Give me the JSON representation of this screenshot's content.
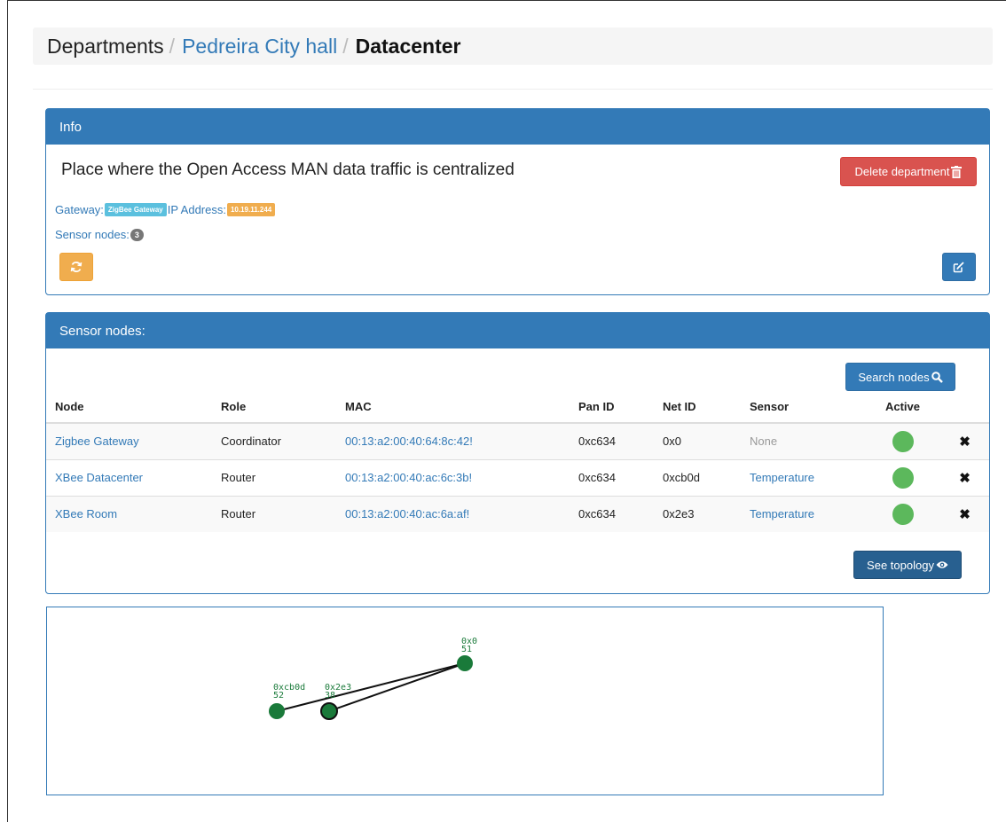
{
  "breadcrumb": {
    "root": "Departments",
    "parent": "Pedreira City hall",
    "current": "Datacenter",
    "separator": "/"
  },
  "info": {
    "heading": "Info",
    "description": "Place where the Open Access MAN data traffic is centralized",
    "delete_label": "Delete department",
    "gateway_label": "Gateway:",
    "gateway_value": "ZigBee Gateway",
    "ip_label": "IP Address:",
    "ip_value": "10.19.11.244",
    "sensor_nodes_label": "Sensor nodes:",
    "sensor_nodes_count": "3"
  },
  "sensor_panel": {
    "heading": "Sensor nodes:",
    "search_label": "Search nodes",
    "columns": [
      "Node",
      "Role",
      "MAC",
      "Pan ID",
      "Net ID",
      "Sensor",
      "Active"
    ],
    "rows": [
      {
        "node": "Zigbee Gateway",
        "role": "Coordinator",
        "mac": "00:13:a2:00:40:64:8c:42!",
        "pan_id": "0xc634",
        "net_id": "0x0",
        "sensor": "None",
        "active": true
      },
      {
        "node": "XBee Datacenter",
        "role": "Router",
        "mac": "00:13:a2:00:40:ac:6c:3b!",
        "pan_id": "0xc634",
        "net_id": "0xcb0d",
        "sensor": "Temperature",
        "active": true
      },
      {
        "node": "XBee Room",
        "role": "Router",
        "mac": "00:13:a2:00:40:ac:6a:af!",
        "pan_id": "0xc634",
        "net_id": "0x2e3",
        "sensor": "Temperature",
        "active": true
      }
    ],
    "topology_label": "See topology"
  },
  "topology": {
    "nodes": [
      {
        "id": "0x0",
        "value": "51"
      },
      {
        "id": "0xcb0d",
        "value": "52"
      },
      {
        "id": "0x2e3",
        "value": "38"
      }
    ],
    "links": [
      [
        "0xcb0d",
        "0x0"
      ],
      [
        "0x2e3",
        "0x0"
      ]
    ],
    "node_color": "#1a7a3a",
    "label_color": "#1a7a3a"
  },
  "colors": {
    "primary": "#337ab7",
    "danger": "#d9534f",
    "warning": "#f0ad4e",
    "info": "#5bc0de",
    "success": "#5cb85c"
  }
}
